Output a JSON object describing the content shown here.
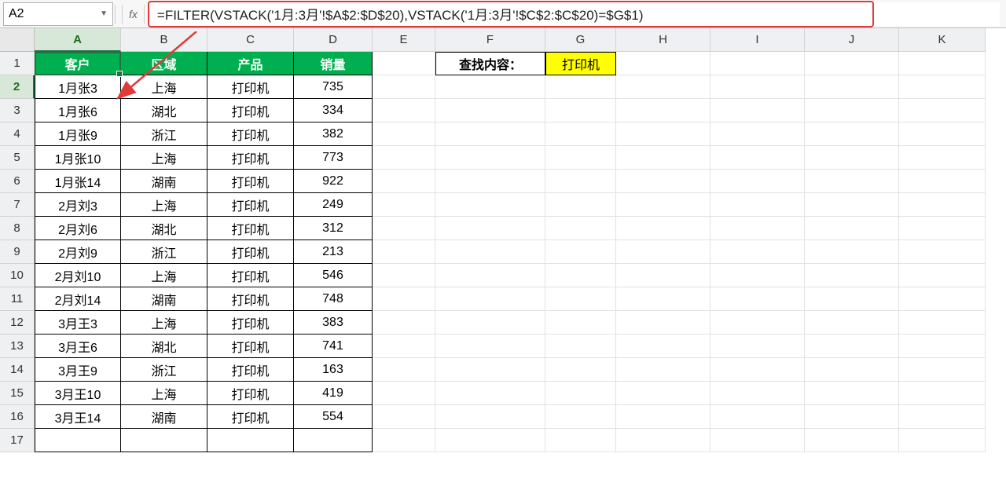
{
  "name_box": "A2",
  "fx_label": "fx",
  "formula": "=FILTER(VSTACK('1月:3月'!$A$2:$D$20),VSTACK('1月:3月'!$C$2:$C$20)=$G$1)",
  "columns": [
    "A",
    "B",
    "C",
    "D",
    "E",
    "F",
    "G",
    "H",
    "I",
    "J",
    "K"
  ],
  "row_numbers": [
    "1",
    "2",
    "3",
    "4",
    "5",
    "6",
    "7",
    "8",
    "9",
    "10",
    "11",
    "12",
    "13",
    "14",
    "15",
    "16",
    "17"
  ],
  "headers": [
    "客户",
    "区域",
    "产品",
    "销量"
  ],
  "lookup": {
    "label": "查找内容：",
    "value": "打印机"
  },
  "data": [
    [
      "1月张3",
      "上海",
      "打印机",
      "735"
    ],
    [
      "1月张6",
      "湖北",
      "打印机",
      "334"
    ],
    [
      "1月张9",
      "浙江",
      "打印机",
      "382"
    ],
    [
      "1月张10",
      "上海",
      "打印机",
      "773"
    ],
    [
      "1月张14",
      "湖南",
      "打印机",
      "922"
    ],
    [
      "2月刘3",
      "上海",
      "打印机",
      "249"
    ],
    [
      "2月刘6",
      "湖北",
      "打印机",
      "312"
    ],
    [
      "2月刘9",
      "浙江",
      "打印机",
      "213"
    ],
    [
      "2月刘10",
      "上海",
      "打印机",
      "546"
    ],
    [
      "2月刘14",
      "湖南",
      "打印机",
      "748"
    ],
    [
      "3月王3",
      "上海",
      "打印机",
      "383"
    ],
    [
      "3月王6",
      "湖北",
      "打印机",
      "741"
    ],
    [
      "3月王9",
      "浙江",
      "打印机",
      "163"
    ],
    [
      "3月王10",
      "上海",
      "打印机",
      "419"
    ],
    [
      "3月王14",
      "湖南",
      "打印机",
      "554"
    ]
  ],
  "colors": {
    "header_green": "#00b050",
    "lookup_yellow": "#ffff00",
    "selection_green": "#207245",
    "highlight_red": "#e03a3a"
  },
  "active_cell": "A2"
}
